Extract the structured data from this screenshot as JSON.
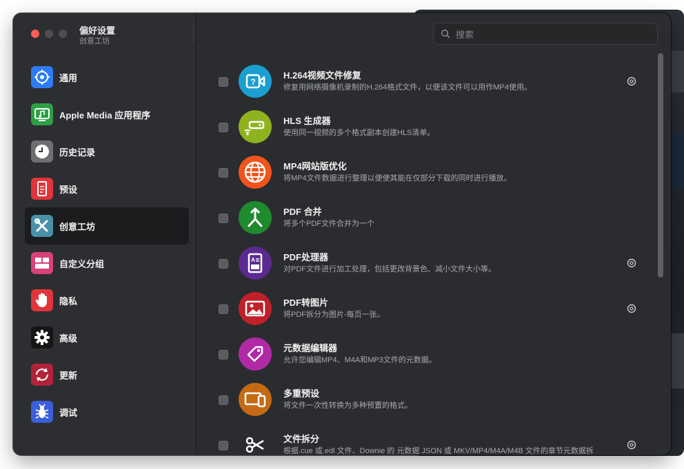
{
  "window": {
    "title": "偏好设置",
    "subtitle": "创意工坊"
  },
  "search": {
    "placeholder": "搜索"
  },
  "colors": {
    "accent_red": "#ff5f57",
    "sidebar_bg": "#2c2e31",
    "content_bg": "#2a2c2f"
  },
  "sidebar": {
    "items": [
      {
        "label": "通用",
        "icon": "gear-cog-icon",
        "color": "#2e7cf6"
      },
      {
        "label": "Apple Media 应用程序",
        "icon": "music-display-icon",
        "color": "#2ea043"
      },
      {
        "label": "历史记录",
        "icon": "clock-icon",
        "color": "#6e6f72"
      },
      {
        "label": "预设",
        "icon": "document-icon",
        "color": "#e0353b"
      },
      {
        "label": "创意工坊",
        "icon": "tools-icon",
        "color": "#4a90a8",
        "active": true
      },
      {
        "label": "自定义分组",
        "icon": "grid-icon",
        "color": "#d8417a"
      },
      {
        "label": "隐私",
        "icon": "hand-icon",
        "color": "#e0353b"
      },
      {
        "label": "高级",
        "icon": "gear-icon",
        "color": "#151515"
      },
      {
        "label": "更新",
        "icon": "refresh-icon",
        "color": "#b0233a"
      },
      {
        "label": "调试",
        "icon": "bug-icon",
        "color": "#3b5fd8"
      }
    ]
  },
  "workshop": {
    "items": [
      {
        "title": "H.264视频文件修复",
        "desc": "修复用网络摄像机录制的H.264格式文件，以便该文件可以用作MP4使用。",
        "icon": "video-repair-icon",
        "color": "#1a9fd0",
        "gear": true
      },
      {
        "title": "HLS 生成器",
        "desc": "使用同一视频的多个格式副本创建HLS清单。",
        "icon": "streaming-icon",
        "color": "#8fb31e",
        "gear": false
      },
      {
        "title": "MP4网站版优化",
        "desc": "将MP4文件数据进行整理以便使其能在仅部分下载的同时进行播放。",
        "icon": "globe-icon",
        "color": "#f2541b",
        "gear": false
      },
      {
        "title": "PDF 合并",
        "desc": "将多个PDF文件合并为一个",
        "icon": "merge-icon",
        "color": "#1f8a2e",
        "gear": false
      },
      {
        "title": "PDF处理器",
        "desc": "对PDF文件进行加工处理，包括更改背景色、减小文件大小等。",
        "icon": "pdf-process-icon",
        "color": "#5b2a8f",
        "gear": true
      },
      {
        "title": "PDF转图片",
        "desc": "将PDF拆分为图片-每页一张。",
        "icon": "image-icon",
        "color": "#c0202a",
        "gear": true
      },
      {
        "title": "元数据编辑器",
        "desc": "允许您编辑MP4、M4A和MP3文件的元数据。",
        "icon": "tag-icon",
        "color": "#b02aa6",
        "gear": false
      },
      {
        "title": "多重预设",
        "desc": "将文件一次性转换为多种预置的格式。",
        "icon": "devices-icon",
        "color": "#c46a14",
        "gear": false
      },
      {
        "title": "文件拆分",
        "desc": "根据.cue 或.edl 文件、Downie 的 元数据 JSON 或 MKV/MP4/M4A/M4B 文件的章节元数据拆",
        "icon": "scissors-icon",
        "color": "#2a2c2f",
        "gear": true
      }
    ]
  }
}
